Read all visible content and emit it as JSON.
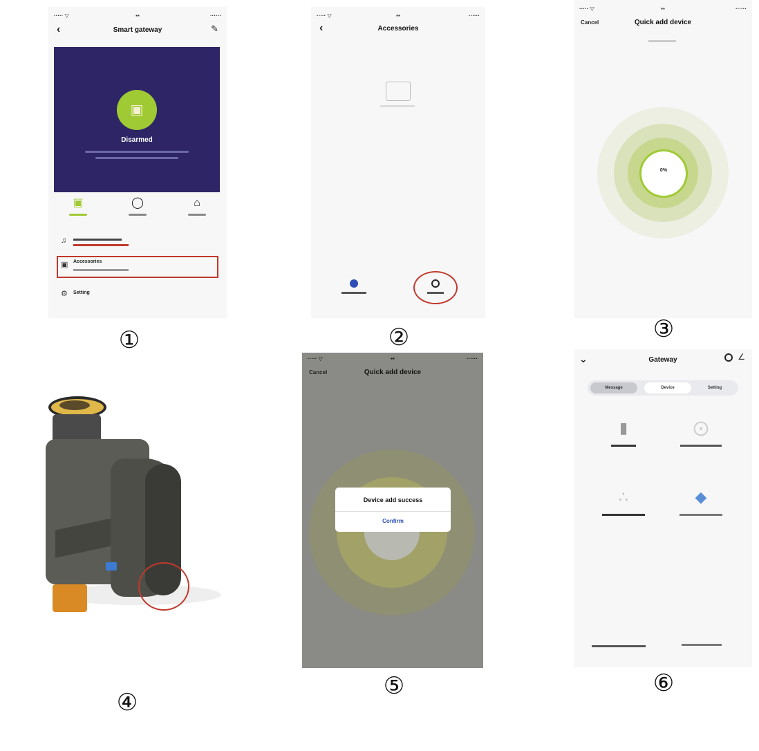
{
  "colors": {
    "hero_bg": "#2e2566",
    "accent_green": "#9fca34",
    "highlight_red": "#c0392b",
    "link_blue": "#2e4fb6"
  },
  "steps": {
    "s1": "①",
    "s2": "②",
    "s3": "③",
    "s4": "④",
    "s5": "⑤",
    "s6": "⑥"
  },
  "panel1": {
    "status": {
      "left": "····· ▽",
      "center": "▪▪",
      "right": "······"
    },
    "back_icon": "chevron-left-icon",
    "title": "Smart gateway",
    "edit_icon": "pencil-icon",
    "lock_icon": "lock-icon",
    "hero_status": "Disarmed",
    "modes": [
      {
        "icon": "lock-open-icon",
        "glyph": "🔓"
      },
      {
        "icon": "shield-icon",
        "glyph": "⛨"
      },
      {
        "icon": "home-icon",
        "glyph": "⌂"
      }
    ],
    "list": [
      {
        "icon": "bell-icon",
        "glyph": "♪"
      },
      {
        "icon": "accessories-icon",
        "glyph": "▣",
        "title": "Accessories"
      },
      {
        "icon": "gear-icon",
        "glyph": "⚙",
        "title": "Setting"
      }
    ]
  },
  "panel2": {
    "status": {
      "left": "····· ▽",
      "center": "▪▪",
      "right": "······"
    },
    "back_icon": "chevron-left-icon",
    "title": "Accessories",
    "empty_icon": "empty-box-icon",
    "left_action_icon": "plus-circle-icon",
    "right_action_icon": "search-icon"
  },
  "panel3": {
    "status": {
      "left": "····· ▽",
      "center": "▪▪",
      "right": "······"
    },
    "cancel": "Cancel",
    "title": "Quick add device",
    "progress_percent": 0
  },
  "panel4": {
    "product": "water-timer-image",
    "button_icon": "pairing-button-icon"
  },
  "panel5": {
    "status": {
      "left": "····· ▽",
      "center": "▪▪",
      "right": "······"
    },
    "cancel": "Cancel",
    "title": "Quick add device",
    "dialog_title": "Device add success",
    "dialog_confirm": "Confirm"
  },
  "panel6": {
    "back_icon": "chevron-down-icon",
    "title": "Gateway",
    "tabs": [
      "Message",
      "Device",
      "Setting"
    ],
    "devices": [
      {
        "icon": "sensor-icon",
        "glyph": "▮"
      },
      {
        "icon": "timer-icon",
        "glyph": "⨲"
      },
      {
        "icon": "siren-icon",
        "glyph": "∴"
      },
      {
        "icon": "valve-icon",
        "glyph": "♦"
      }
    ],
    "footer_left_icon": "plus-icon",
    "footer_right_icon": "gear-icon"
  }
}
